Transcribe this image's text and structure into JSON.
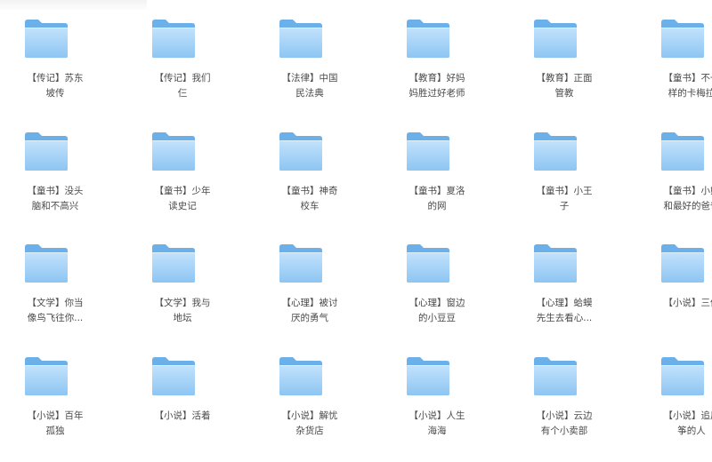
{
  "folders": [
    {
      "label": "【传记】苏东\n坡传"
    },
    {
      "label": "【传记】我们\n仨"
    },
    {
      "label": "【法律】中国\n民法典"
    },
    {
      "label": "【教育】好妈\n妈胜过好老师"
    },
    {
      "label": "【教育】正面\n管教"
    },
    {
      "label": "【童书】不一\n样的卡梅拉"
    },
    {
      "label": "【童书】没头\n脑和不高兴"
    },
    {
      "label": "【童书】少年\n读史记"
    },
    {
      "label": "【童书】神奇\n校车"
    },
    {
      "label": "【童书】夏洛\n的网"
    },
    {
      "label": "【童书】小王\n子"
    },
    {
      "label": "【童书】小熊\n和最好的爸爸"
    },
    {
      "label": "【文学】你当\n像鸟飞往你..."
    },
    {
      "label": "【文学】我与\n地坛"
    },
    {
      "label": "【心理】被讨\n厌的勇气"
    },
    {
      "label": "【心理】窗边\n的小豆豆"
    },
    {
      "label": "【心理】蛤蟆\n先生去看心..."
    },
    {
      "label": "【小说】三体"
    },
    {
      "label": "【小说】百年\n孤独"
    },
    {
      "label": "【小说】活着"
    },
    {
      "label": "【小说】解忧\n杂货店"
    },
    {
      "label": "【小说】人生\n海海"
    },
    {
      "label": "【小说】云边\n有个小卖部"
    },
    {
      "label": "【小说】追风\n筝的人"
    }
  ],
  "colors": {
    "folder_back": "#6fb2ea",
    "folder_front_top": "#bfe0fb",
    "folder_front_bottom": "#8cc6f3",
    "label_text": "#4a4a4a"
  }
}
